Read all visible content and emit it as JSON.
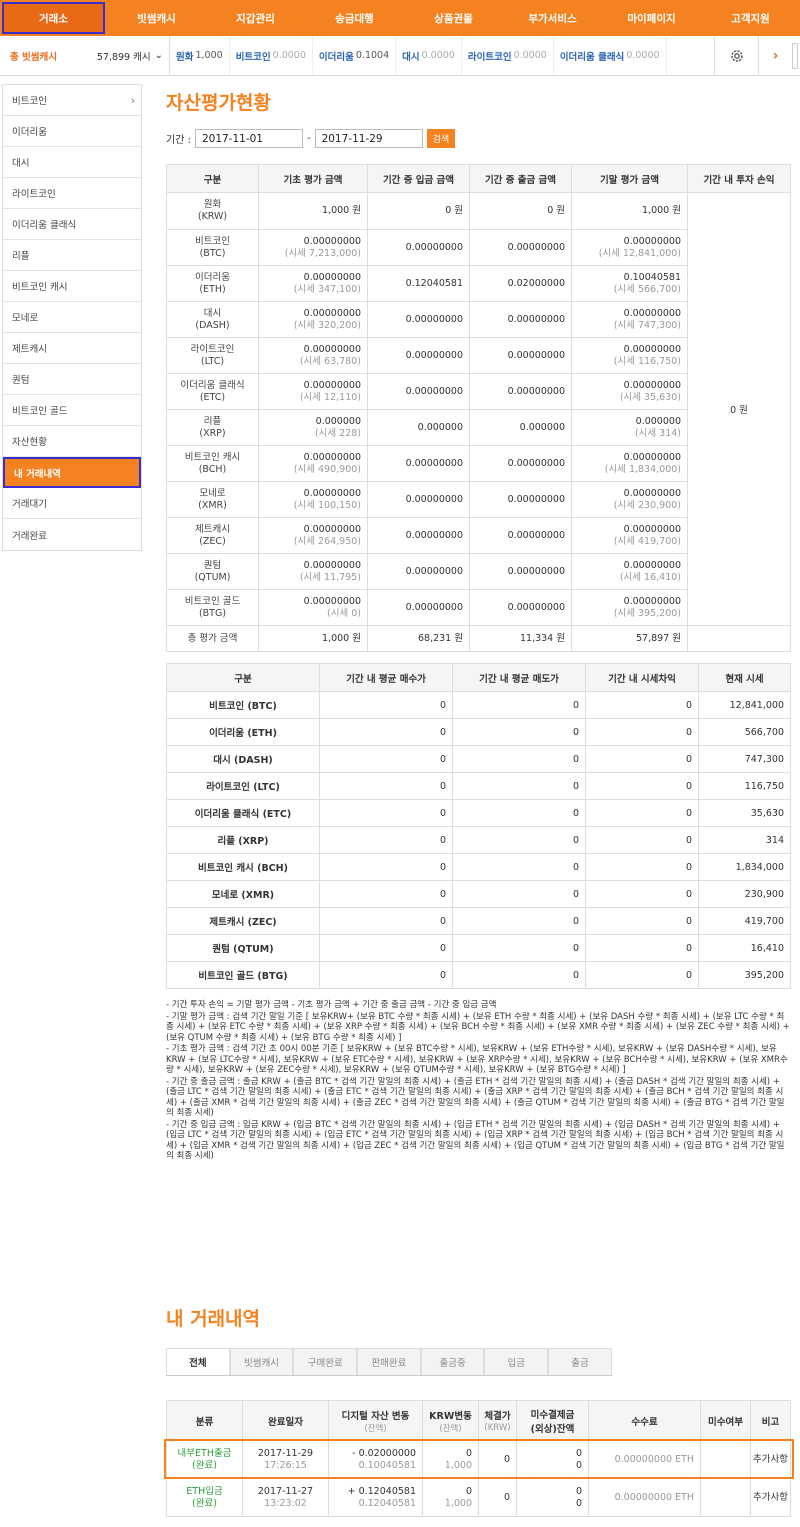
{
  "nav": {
    "items": [
      "거래소",
      "빗썸캐시",
      "지갑관리",
      "송금대행",
      "상품권몰",
      "부가서비스",
      "마이페이지",
      "고객지원"
    ]
  },
  "subbar": {
    "total_label": "총 빗썸캐시",
    "total_value": "57,899 캐시",
    "ticker": [
      {
        "name": "원화",
        "value": "1,000",
        "dim": false
      },
      {
        "name": "비트코인",
        "value": "0.0000",
        "dim": true
      },
      {
        "name": "이더리움",
        "value": "0.1004",
        "dim": false
      },
      {
        "name": "대시",
        "value": "0.0000",
        "dim": true
      },
      {
        "name": "라이트코인",
        "value": "0.0000",
        "dim": true
      },
      {
        "name": "이더리움 클래식",
        "value": "0.0000",
        "dim": true
      }
    ]
  },
  "sidebar": {
    "items": [
      "비트코인",
      "이더리움",
      "대시",
      "라이트코인",
      "이더리움 클래식",
      "리플",
      "비트코인 캐시",
      "모네로",
      "제트캐시",
      "퀀텀",
      "비트코인 골드",
      "자산현황",
      "내 거래내역",
      "거래대기",
      "거래완료"
    ]
  },
  "asset": {
    "title": "자산평가현황",
    "period_label": "기간 :",
    "date_from": "2017-11-01",
    "date_sep": "-",
    "date_to": "2017-11-29",
    "search_label": "검색",
    "headers": [
      "구분",
      "기초 평가 금액",
      "기간 중 입금 금액",
      "기간 중 출금 금액",
      "기말 평가 금액",
      "기간 내 투자 손익"
    ],
    "rows": [
      {
        "name1": "원화",
        "name2": "(KRW)",
        "begin": "1,000 원",
        "begin_sub": "",
        "deposit": "0 원",
        "withdraw": "0 원",
        "end": "1,000 원",
        "end_sub": ""
      },
      {
        "name1": "비트코인",
        "name2": "(BTC)",
        "begin": "0.00000000",
        "begin_sub": "(시세 7,213,000)",
        "deposit": "0.00000000",
        "withdraw": "0.00000000",
        "end": "0.00000000",
        "end_sub": "(시세 12,841,000)"
      },
      {
        "name1": "이더리움",
        "name2": "(ETH)",
        "begin": "0.00000000",
        "begin_sub": "(시세 347,100)",
        "deposit": "0.12040581",
        "withdraw": "0.02000000",
        "end": "0.10040581",
        "end_sub": "(시세 566,700)"
      },
      {
        "name1": "대시",
        "name2": "(DASH)",
        "begin": "0.00000000",
        "begin_sub": "(시세 320,200)",
        "deposit": "0.00000000",
        "withdraw": "0.00000000",
        "end": "0.00000000",
        "end_sub": "(시세 747,300)"
      },
      {
        "name1": "라이트코인",
        "name2": "(LTC)",
        "begin": "0.00000000",
        "begin_sub": "(시세 63,780)",
        "deposit": "0.00000000",
        "withdraw": "0.00000000",
        "end": "0.00000000",
        "end_sub": "(시세 116,750)"
      },
      {
        "name1": "이더리움 클래식",
        "name2": "(ETC)",
        "begin": "0.00000000",
        "begin_sub": "(시세 12,110)",
        "deposit": "0.00000000",
        "withdraw": "0.00000000",
        "end": "0.00000000",
        "end_sub": "(시세 35,630)"
      },
      {
        "name1": "리플",
        "name2": "(XRP)",
        "begin": "0.000000",
        "begin_sub": "(시세 228)",
        "deposit": "0.000000",
        "withdraw": "0.000000",
        "end": "0.000000",
        "end_sub": "(시세 314)"
      },
      {
        "name1": "비트코인 캐시",
        "name2": "(BCH)",
        "begin": "0.00000000",
        "begin_sub": "(시세 490,900)",
        "deposit": "0.00000000",
        "withdraw": "0.00000000",
        "end": "0.00000000",
        "end_sub": "(시세 1,834,000)"
      },
      {
        "name1": "모네로",
        "name2": "(XMR)",
        "begin": "0.00000000",
        "begin_sub": "(시세 100,150)",
        "deposit": "0.00000000",
        "withdraw": "0.00000000",
        "end": "0.00000000",
        "end_sub": "(시세 230,900)"
      },
      {
        "name1": "제트캐시",
        "name2": "(ZEC)",
        "begin": "0.00000000",
        "begin_sub": "(시세 264,950)",
        "deposit": "0.00000000",
        "withdraw": "0.00000000",
        "end": "0.00000000",
        "end_sub": "(시세 419,700)"
      },
      {
        "name1": "퀀텀",
        "name2": "(QTUM)",
        "begin": "0.00000000",
        "begin_sub": "(시세 11,795)",
        "deposit": "0.00000000",
        "withdraw": "0.00000000",
        "end": "0.00000000",
        "end_sub": "(시세 16,410)"
      },
      {
        "name1": "비트코인 골드",
        "name2": "(BTG)",
        "begin": "0.00000000",
        "begin_sub": "(시세 0)",
        "deposit": "0.00000000",
        "withdraw": "0.00000000",
        "end": "0.00000000",
        "end_sub": "(시세 395,200)"
      }
    ],
    "profit": "0 원",
    "total": {
      "label": "총 평가 금액",
      "begin": "1,000 원",
      "deposit": "68,231 원",
      "withdraw": "11,334 원",
      "end": "57,897 원"
    }
  },
  "avg": {
    "headers": [
      "구분",
      "기간 내 평균 매수가",
      "기간 내 평균 매도가",
      "기간 내 시세차익",
      "현재 시세"
    ],
    "rows": [
      {
        "name": "비트코인 (BTC)",
        "buy": "0",
        "sell": "0",
        "diff": "0",
        "price": "12,841,000"
      },
      {
        "name": "이더리움 (ETH)",
        "buy": "0",
        "sell": "0",
        "diff": "0",
        "price": "566,700"
      },
      {
        "name": "대시 (DASH)",
        "buy": "0",
        "sell": "0",
        "diff": "0",
        "price": "747,300"
      },
      {
        "name": "라이트코인 (LTC)",
        "buy": "0",
        "sell": "0",
        "diff": "0",
        "price": "116,750"
      },
      {
        "name": "이더리움 클래식 (ETC)",
        "buy": "0",
        "sell": "0",
        "diff": "0",
        "price": "35,630"
      },
      {
        "name": "리플 (XRP)",
        "buy": "0",
        "sell": "0",
        "diff": "0",
        "price": "314"
      },
      {
        "name": "비트코인 캐시 (BCH)",
        "buy": "0",
        "sell": "0",
        "diff": "0",
        "price": "1,834,000"
      },
      {
        "name": "모네로 (XMR)",
        "buy": "0",
        "sell": "0",
        "diff": "0",
        "price": "230,900"
      },
      {
        "name": "제트캐시 (ZEC)",
        "buy": "0",
        "sell": "0",
        "diff": "0",
        "price": "419,700"
      },
      {
        "name": "퀀텀 (QTUM)",
        "buy": "0",
        "sell": "0",
        "diff": "0",
        "price": "16,410"
      },
      {
        "name": "비트코인 골드 (BTG)",
        "buy": "0",
        "sell": "0",
        "diff": "0",
        "price": "395,200"
      }
    ]
  },
  "notes": [
    "- 기간 투자 손익 = 기말 평가 금액 - 기초 평가 금액 + 기간 중 출금 금액 - 기간 중 입금 금액",
    "- 기말 평가 금액 : 검색 기간 말일 기준 [ 보유KRW+ (보유 BTC 수량 * 최종 시세) + (보유 ETH 수량 * 최종 시세) + (보유 DASH 수량 * 최종 시세) + (보유 LTC 수량 * 최종 시세) + (보유 ETC 수량 * 최종 시세) + (보유 XRP 수량 * 최종 시세) + (보유 BCH 수량 * 최종 시세) + (보유 XMR 수량 * 최종 시세) + (보유 ZEC 수량 * 최종 시세) + (보유 QTUM 수량 * 최종 시세) + (보유 BTG 수량 * 최종 시세) ]",
    "- 기초 평가 금액 : 검색 기간 초 00시 00분 기준 [ 보유KRW + (보유 BTC수량 * 시세), 보유KRW + (보유 ETH수량 * 시세), 보유KRW + (보유 DASH수량 * 시세), 보유KRW + (보유 LTC수량 * 시세), 보유KRW + (보유 ETC수량 * 시세), 보유KRW + (보유 XRP수량 * 시세), 보유KRW + (보유 BCH수량 * 시세), 보유KRW + (보유 XMR수량 * 시세), 보유KRW + (보유 ZEC수량 * 시세), 보유KRW + (보유 QTUM수량 * 시세), 보유KRW + (보유 BTG수량 * 시세) ]",
    "- 기간 중 출금 금액 : 출금 KRW + (출금 BTC * 검색 기간 말일의 최종 시세) + (출금 ETH * 검색 기간 말일의 최종 시세) + (출금 DASH * 검색 기간 말일의 최종 시세) + (출금 LTC * 검색 기간 말일의 최종 시세) + (출금 ETC * 검색 기간 말일의 최종 시세) + (출금 XRP * 검색 기간 말일의 최종 시세) + (출금 BCH * 검색 기간 말일의 최종 시세) + (출금 XMR * 검색 기간 말일의 최종 시세) + (출금 ZEC * 검색 기간 말일의 최종 시세) + (출금 QTUM * 검색 기간 말일의 최종 시세) + (출금 BTG * 검색 기간 말일의 최종 시세)",
    "- 기간 중 입금 금액 : 입금 KRW + (입금 BTC * 검색 기간 말일의 최종 시세) + (입금 ETH * 검색 기간 말일의 최종 시세) + (입금 DASH * 검색 기간 말일의 최종 시세) + (입금 LTC * 검색 기간 말일의 최종 시세) + (입금 ETC * 검색 기간 말일의 최종 시세) + (입금 XRP * 검색 기간 말일의 최종 시세) + (입금 BCH * 검색 기간 말일의 최종 시세) + (입금 XMR * 검색 기간 말일의 최종 시세) + (입금 ZEC * 검색 기간 말일의 최종 시세) + (입금 QTUM * 검색 기간 말일의 최종 시세) + (입금 BTG * 검색 기간 말일의 최종 시세)"
  ],
  "history": {
    "title": "내 거래내역",
    "tabs": [
      "전체",
      "빗썸캐시",
      "구매완료",
      "판매완료",
      "출금중",
      "입금",
      "출금"
    ],
    "headers": {
      "type": "분류",
      "date": "완료일자",
      "asset": "디지털 자산 변동",
      "asset_sub": "(잔액)",
      "krw": "KRW변동",
      "krw_sub": "(잔액)",
      "price": "체결가",
      "price_sub": "(KRW)",
      "unsettled": "미수결제금",
      "unsettled_sub": "(외상)잔액",
      "fee": "수수료",
      "unpaid": "미수여부",
      "note": "비고"
    },
    "rows": [
      {
        "type1": "내부ETH출금",
        "type2": "(완료)",
        "date": "2017-11-29",
        "time": "17:26:15",
        "asset": "- 0.02000000",
        "asset_bal": "0.10040581",
        "krw": "0",
        "krw_bal": "1,000",
        "price": "0",
        "uns1": "0",
        "uns2": "0",
        "fee": "0.00000000 ETH",
        "unpaid": "",
        "note": "추가사항"
      },
      {
        "type1": "ETH입금",
        "type2": "(완료)",
        "date": "2017-11-27",
        "time": "13:23:02",
        "asset": "+ 0.12040581",
        "asset_bal": "0.12040581",
        "krw": "0",
        "krw_bal": "1,000",
        "price": "0",
        "uns1": "0",
        "uns2": "0",
        "fee": "0.00000000 ETH",
        "unpaid": "",
        "note": "추가사항"
      }
    ]
  },
  "colors": {
    "accent": "#f58220",
    "accent_dark": "#e86a16",
    "highlight_border": "#3b2ccc",
    "link_blue": "#2a64b5",
    "green": "#2a9d38"
  }
}
